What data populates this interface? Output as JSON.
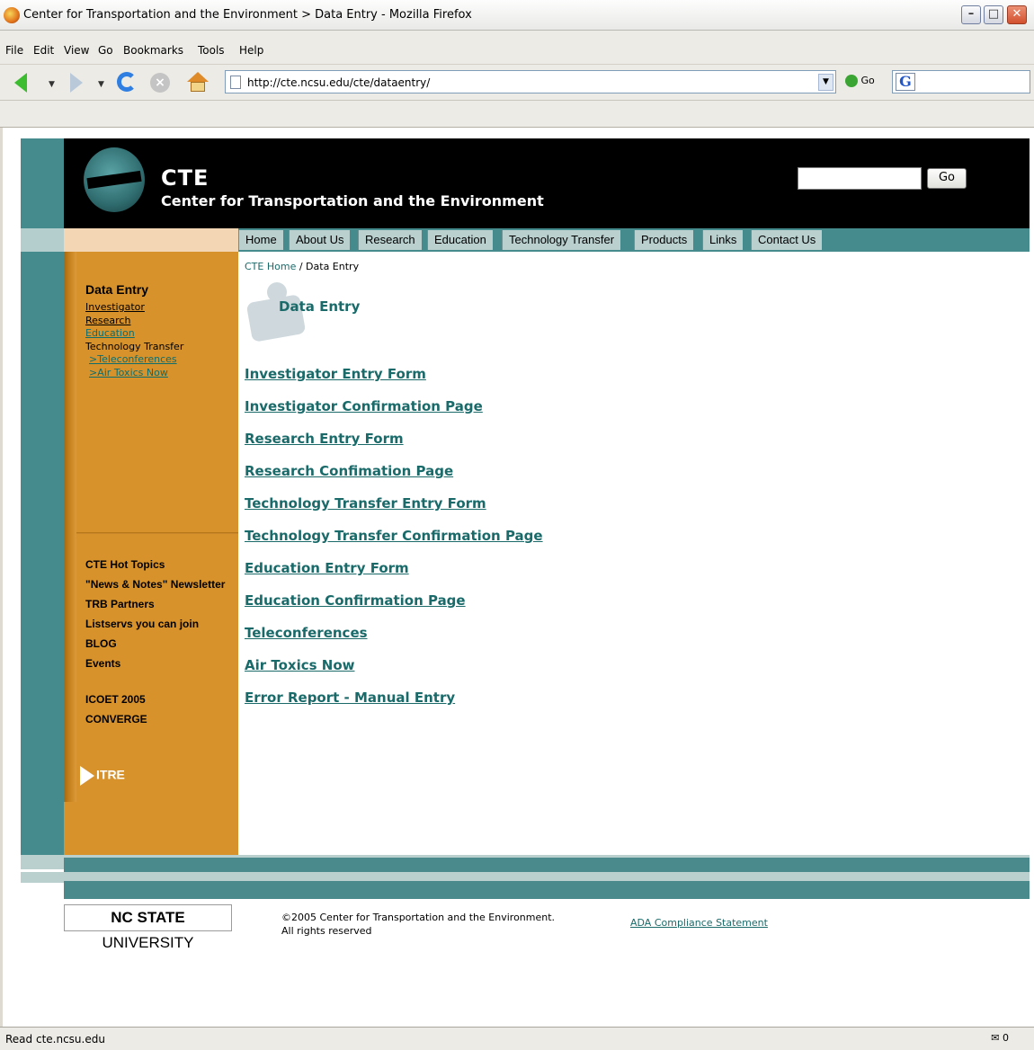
{
  "window": {
    "title": "Center for Transportation and the Environment > Data Entry - Mozilla Firefox",
    "min": "–",
    "max": "□",
    "close": "✕"
  },
  "menu": [
    "File",
    "Edit",
    "View",
    "Go",
    "Bookmarks",
    "Tools",
    "Help"
  ],
  "toolbar": {
    "url": "http://cte.ncsu.edu/cte/dataentry/",
    "go_label": "Go",
    "google_glyph": "G"
  },
  "site": {
    "logo_abbr": "CTE",
    "logo_full": "Center for Transportation and the Environment",
    "search_go": "Go"
  },
  "topnav": [
    "Home",
    "About Us",
    "Research",
    "Education",
    "Technology Transfer",
    "Products",
    "Links",
    "Contact Us"
  ],
  "sidebar": {
    "heading": "Data Entry",
    "links": [
      {
        "label": "Investigator",
        "style": "black"
      },
      {
        "label": "Research",
        "style": "black"
      },
      {
        "label": "Education",
        "style": "teal"
      },
      {
        "label": "Technology Transfer",
        "style": "black-nounder"
      },
      {
        "label": ">Teleconferences",
        "style": "teal"
      },
      {
        "label": ">Air Toxics Now",
        "style": "teal"
      }
    ],
    "hot": [
      "CTE Hot Topics",
      "\"News & Notes\" Newsletter",
      "TRB Partners",
      "Listservs you can join",
      "BLOG",
      "Events",
      "",
      "ICOET 2005",
      "CONVERGE"
    ],
    "itre": "ITRE"
  },
  "breadcrumb": {
    "home": "CTE Home",
    "sep": " / ",
    "current": "Data Entry"
  },
  "page_title": "Data Entry",
  "main_links": [
    "Investigator Entry Form",
    "Investigator Confirmation Page",
    "Research Entry Form",
    "Research Confimation Page",
    "Technology Transfer Entry Form",
    "Technology Transfer Confirmation Page",
    "Education Entry Form",
    "Education Confirmation Page",
    "Teleconferences",
    "Air Toxics Now",
    "Error Report - Manual Entry"
  ],
  "footer": {
    "ncstate_bold": "NC STATE",
    "ncstate_rest": " UNIVERSITY",
    "copyright_line1": "©2005 Center for Transportation and the Environment.",
    "copyright_line2": "All rights reserved",
    "ada": "ADA Compliance Statement"
  },
  "status": {
    "text": "Read cte.ncsu.edu",
    "mail_count": "0"
  },
  "icons": [
    "firefox-icon",
    "back-arrow-icon",
    "forward-arrow-icon",
    "reload-icon",
    "stop-icon",
    "home-icon",
    "page-icon",
    "go-icon",
    "google-icon",
    "globe-logo-icon",
    "puzzle-icon",
    "itre-arrow-icon",
    "mail-icon"
  ]
}
